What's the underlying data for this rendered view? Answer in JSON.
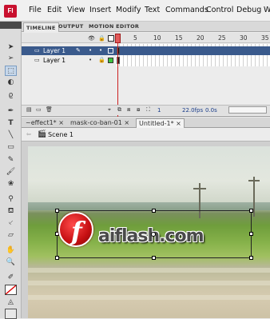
{
  "app": {
    "logo": "Fl"
  },
  "menu": [
    "File",
    "Edit",
    "View",
    "Insert",
    "Modify",
    "Text",
    "Commands",
    "Control",
    "Debug",
    "W"
  ],
  "timeline": {
    "tabs": [
      "TIMELINE",
      "OUTPUT",
      "MOTION EDITOR"
    ],
    "ruler": [
      "5",
      "10",
      "15",
      "20",
      "25",
      "30",
      "35"
    ],
    "layers": [
      {
        "name": "Layer 1",
        "selected": true
      },
      {
        "name": "Layer 1",
        "selected": false
      }
    ],
    "footer": {
      "frame": "1",
      "fps": "22.0fps",
      "time": "0.0s"
    }
  },
  "doc_tabs": [
    {
      "label": "~effect1*",
      "close": "×"
    },
    {
      "label": "mask-co-ban-01",
      "close": "×"
    },
    {
      "label": "Untitled-1*",
      "close": "×"
    }
  ],
  "editbar": {
    "scene": "Scene 1"
  },
  "stage": {
    "logo_letter": "f",
    "logo_text": "aiflash.com"
  },
  "colors": {
    "accent": "#3a5a8c",
    "brand": "#c8102e",
    "playhead": "#cc2020"
  }
}
